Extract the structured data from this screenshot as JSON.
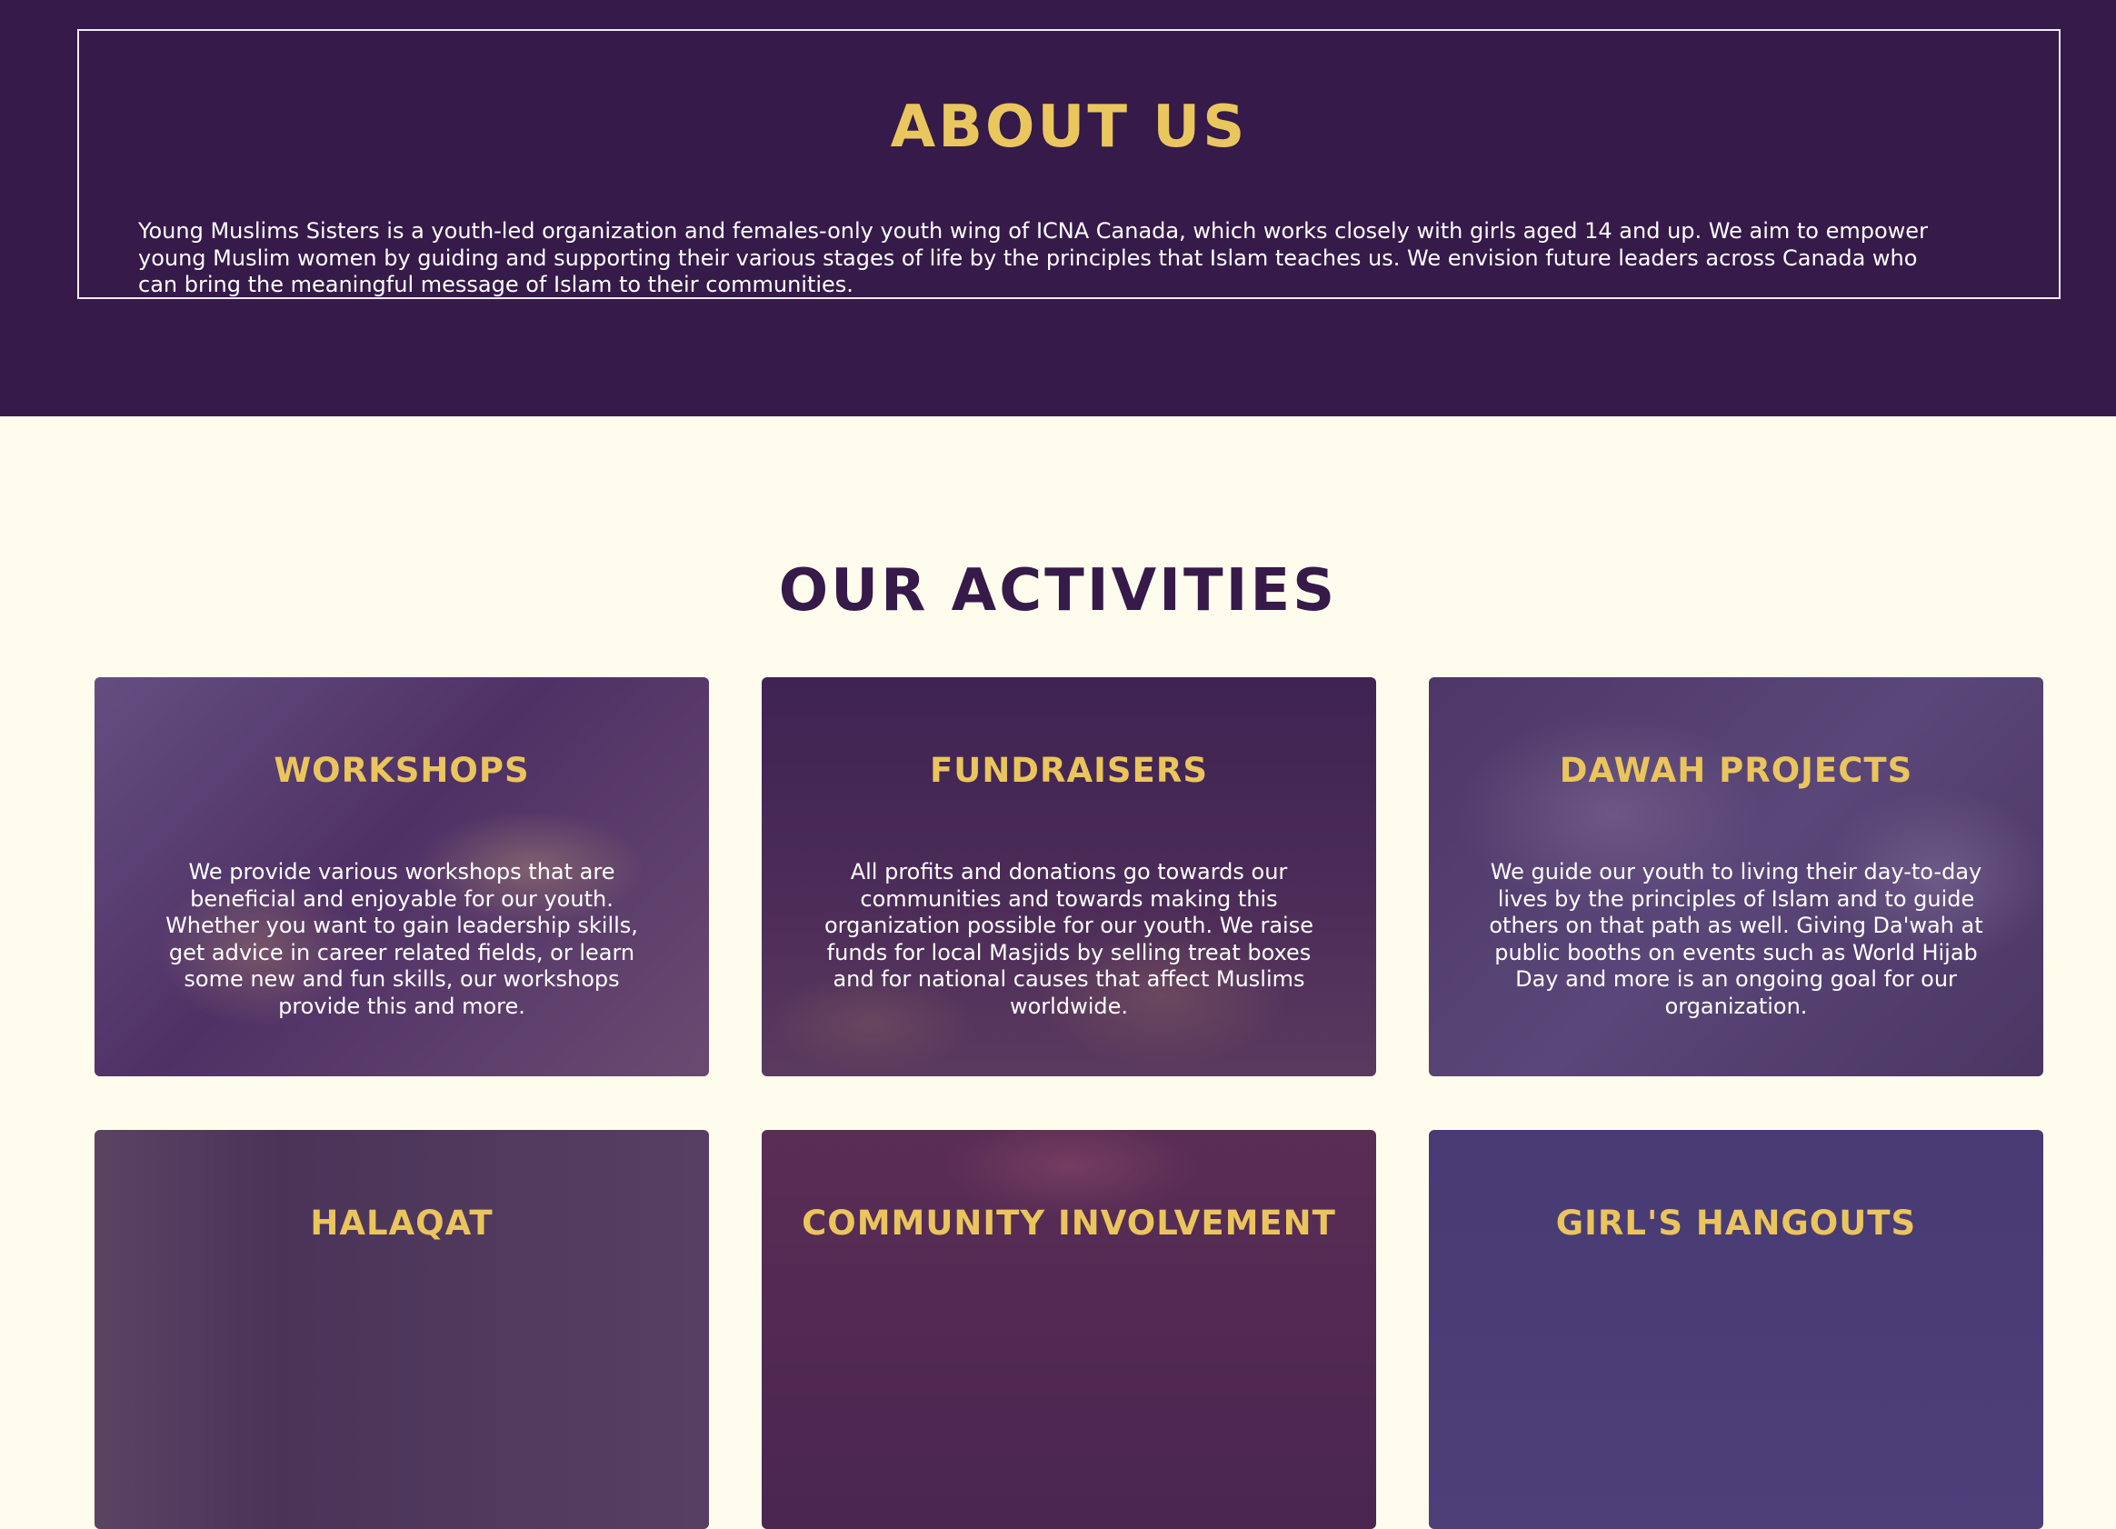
{
  "about": {
    "title": "ABOUT US",
    "text": "Young Muslims Sisters is a youth-led organization and females-only youth wing of ICNA Canada, which works closely with girls aged 14 and up. We aim to empower young Muslim women by guiding and supporting their various stages of life by the principles that Islam teaches us. We envision future leaders across Canada who can bring the meaningful message of Islam to their communities."
  },
  "activities": {
    "title": "OUR ACTIVITIES",
    "cards": [
      {
        "title": "WORKSHOPS",
        "description": "We provide various workshops that are beneficial and enjoyable for our youth. Whether you want to gain leadership skills, get advice in career related fields, or learn some new and fun skills, our workshops provide this and more."
      },
      {
        "title": "FUNDRAISERS",
        "description": "All profits and donations go towards our communities and towards making this organization possible for our youth. We raise funds for local Masjids by selling treat boxes and for national causes that affect Muslims worldwide."
      },
      {
        "title": "DAWAH PROJECTS",
        "description": "We guide our youth to living their day-to-day lives by the principles of Islam and to guide others on that path as well. Giving Da'wah at public booths on events such as World Hijab Day and more is an ongoing goal for our organization."
      },
      {
        "title": "HALAQAT",
        "description": ""
      },
      {
        "title": "COMMUNITY INVOLVEMENT",
        "description": ""
      },
      {
        "title": "GIRL'S HANGOUTS",
        "description": ""
      }
    ]
  },
  "colors": {
    "primary_purple": "#361a49",
    "accent_gold": "#e9c75e",
    "cream_background": "#fefcec"
  }
}
